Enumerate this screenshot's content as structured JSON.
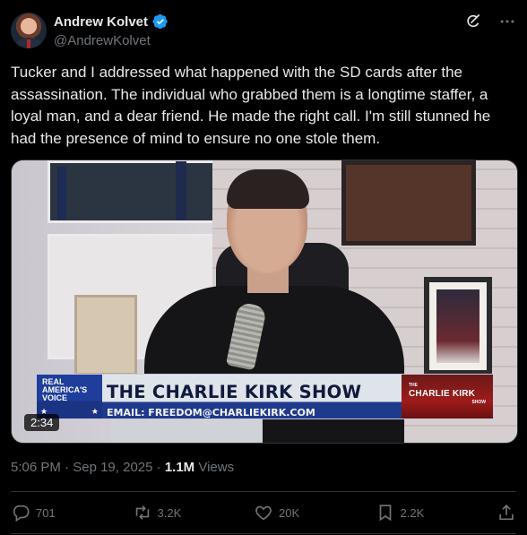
{
  "author": {
    "display_name": "Andrew Kolvet",
    "handle": "@AndrewKolvet",
    "verified": true
  },
  "tweet": {
    "text": "Tucker and I addressed what happened with the SD cards after the assassination. The individual who grabbed them is a longtime staffer, a loyal man, and a dear friend. He made the right call. I'm still stunned he had the presence of mind to ensure no one stole them."
  },
  "media": {
    "duration": "2:34",
    "lower_third": {
      "network_line1": "REAL",
      "network_line2": "AMERICA'S",
      "network_line3": "VOICE",
      "title": "THE CHARLIE KIRK SHOW",
      "email": "EMAIL: FREEDOM@CHARLIEKIRK.COM",
      "show_logo_small": "THE",
      "show_logo_big": "CHARLIE KIRK",
      "show_logo_show": "SHOW"
    }
  },
  "meta": {
    "time": "5:06 PM",
    "date": "Sep 19, 2025",
    "views_count": "1.1M",
    "views_label": "Views"
  },
  "actions": {
    "replies": "701",
    "reposts": "3.2K",
    "likes": "20K",
    "bookmarks": "2.2K"
  },
  "icons": [
    "grok-icon",
    "more-icon",
    "verified-badge-icon",
    "reply-icon",
    "repost-icon",
    "like-icon",
    "bookmark-icon",
    "share-icon"
  ],
  "colors": {
    "verified": "#1d9bf0",
    "muted": "#71767b",
    "text": "#e7e9ea",
    "background": "#000000"
  }
}
